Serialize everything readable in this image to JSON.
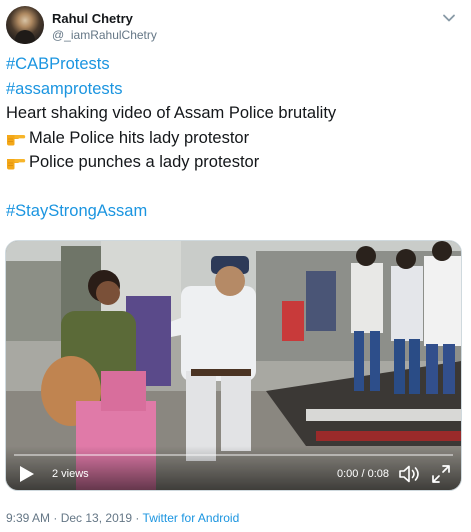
{
  "author": {
    "display_name": "Rahul Chetry",
    "handle": "@_iamRahulChetry"
  },
  "tweet": {
    "hashtag_1": "#CABProtests",
    "hashtag_2": "#assamprotests",
    "line_3": "Heart shaking video of Assam Police brutality",
    "line_4": "Male Police hits lady protestor",
    "line_5": "Police punches a lady protestor",
    "hashtag_3": "#StayStrongAssam"
  },
  "video": {
    "views": "2 views",
    "time": "0:00 / 0:08",
    "progress": 0
  },
  "meta": {
    "time": "9:39 AM",
    "separator_1": " · ",
    "date": "Dec 13, 2019",
    "separator_2": " · ",
    "source": "Twitter for Android"
  },
  "icons": {
    "pointing": "backhand-index-pointing-right-icon",
    "more": "chevron-down-icon",
    "play": "play-icon",
    "volume": "volume-icon",
    "fullscreen": "fullscreen-icon"
  },
  "colors": {
    "link": "#1b95e0",
    "secondary": "#657786"
  }
}
